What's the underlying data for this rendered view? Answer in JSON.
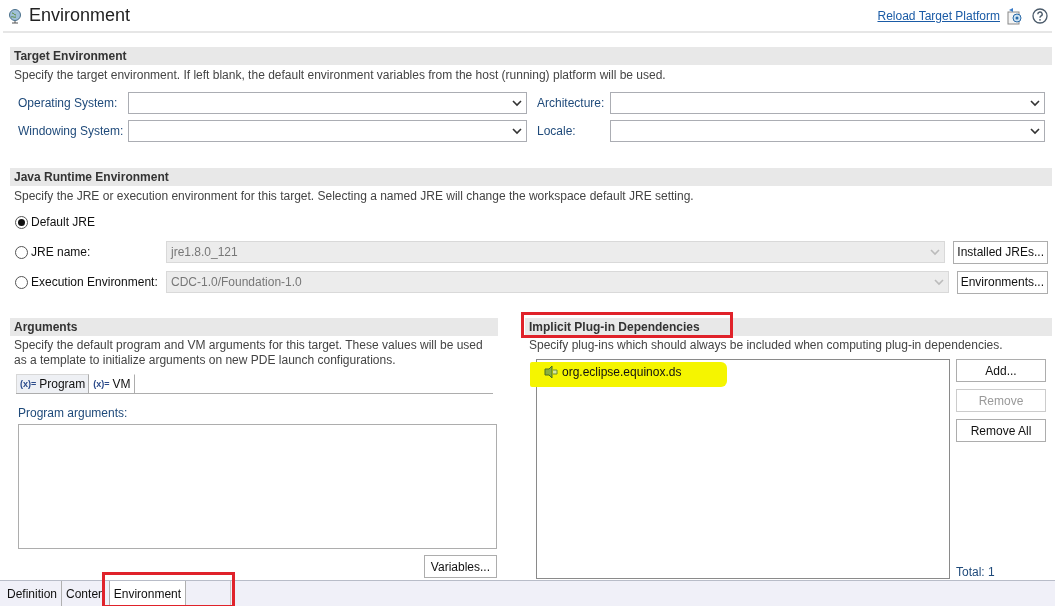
{
  "header": {
    "title": "Environment",
    "link": "Reload Target Platform"
  },
  "target_environment": {
    "title": "Target Environment",
    "description": "Specify the target environment.  If left blank, the default environment variables from the host (running) platform will be used.",
    "fields": [
      {
        "label": "Operating System:"
      },
      {
        "label": "Architecture:"
      },
      {
        "label": "Windowing System:"
      },
      {
        "label": "Locale:"
      }
    ]
  },
  "jre": {
    "title": "Java Runtime Environment",
    "description": "Specify the JRE or execution environment for this target. Selecting a named JRE will change the workspace default JRE setting.",
    "options": [
      {
        "label": "Default JRE",
        "selected": true
      },
      {
        "label": "JRE name:",
        "selected": false,
        "value": "jre1.8.0_121",
        "disabled": true,
        "button": "Installed JREs..."
      },
      {
        "label": "Execution Environment:",
        "selected": false,
        "value": "CDC-1.0/Foundation-1.0",
        "disabled": true,
        "button": "Environments..."
      }
    ]
  },
  "arguments": {
    "title": "Arguments",
    "description": "Specify the default program and VM arguments for this target.  These values will be used as a template to initialize arguments on new PDE launch configurations.",
    "tabs": [
      {
        "icon": "(x)=",
        "label": "Program",
        "selected": true
      },
      {
        "icon": "(x)=",
        "label": "VM",
        "selected": false
      }
    ],
    "field_label": "Program arguments:",
    "button": "Variables..."
  },
  "implicit": {
    "title": "Implicit Plug-in Dependencies",
    "annotated": true,
    "description": "Specify plug-ins which should always be included when computing plug-in dependencies.",
    "items": [
      {
        "label": "org.eclipse.equinox.ds",
        "highlighted": true
      }
    ],
    "buttons": [
      {
        "label": "Add...",
        "disabled": false
      },
      {
        "label": "Remove",
        "disabled": true
      },
      {
        "label": "Remove All",
        "disabled": false
      }
    ],
    "total": "Total: 1"
  },
  "page_tabs": [
    {
      "label": "Definition",
      "selected": false,
      "annotated": false
    },
    {
      "label": "Conten",
      "selected": false,
      "annotated": false
    },
    {
      "label": "Environment",
      "selected": true,
      "annotated": true
    }
  ]
}
